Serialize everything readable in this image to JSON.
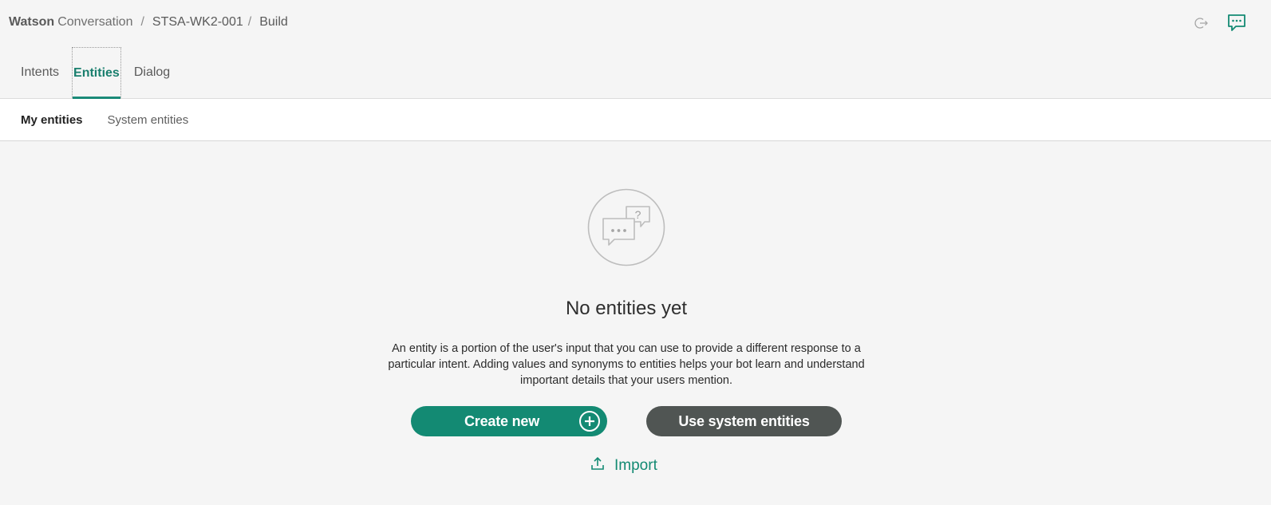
{
  "breadcrumb": {
    "brand_bold": "Watson",
    "brand_light": "Conversation",
    "separator": "/",
    "workspace": "STSA-WK2-001",
    "page": "Build"
  },
  "tabs": [
    {
      "label": "Intents",
      "active": false
    },
    {
      "label": "Entities",
      "active": true
    },
    {
      "label": "Dialog",
      "active": false
    }
  ],
  "subtabs": [
    {
      "label": "My entities",
      "active": true
    },
    {
      "label": "System entities",
      "active": false
    }
  ],
  "empty_state": {
    "icon": "chat-bubbles-question-icon",
    "title": "No entities yet",
    "description": "An entity is a portion of the user's input that you can use to provide a different response to a particular intent. Adding values and synonyms to entities helps your bot learn and understand important details that your users mention."
  },
  "actions": {
    "create_label": "Create new",
    "system_label": "Use system entities",
    "import_label": "Import"
  },
  "icons": {
    "logout": "logout-icon",
    "chat": "chat-icon",
    "plus": "plus-circle-icon",
    "upload": "upload-icon"
  },
  "colors": {
    "accent": "#138a73",
    "dark_button": "#505553",
    "background": "#f5f5f5"
  }
}
